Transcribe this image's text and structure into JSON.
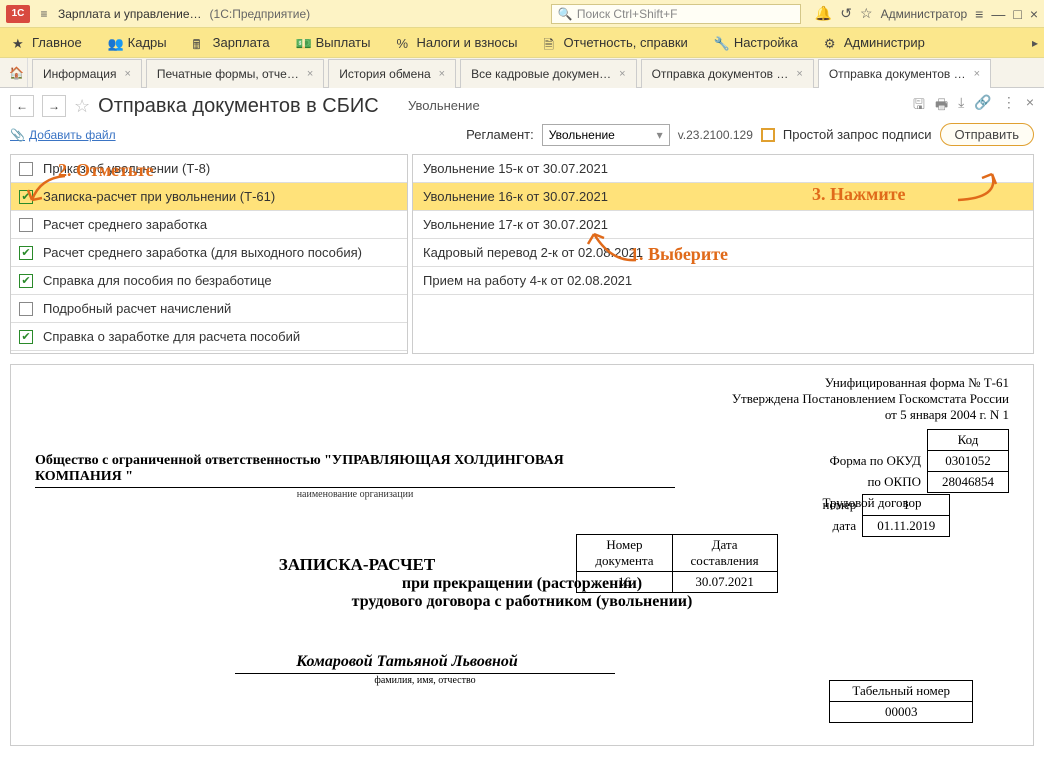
{
  "titlebar": {
    "app": "Зарплата и управление…",
    "subtitle": "(1С:Предприятие)",
    "search_placeholder": "Поиск Ctrl+Shift+F",
    "user": "Администратор"
  },
  "mainmenu": [
    "Главное",
    "Кадры",
    "Зарплата",
    "Выплаты",
    "Налоги и взносы",
    "Отчетность, справки",
    "Настройка",
    "Администрир"
  ],
  "tabs": [
    {
      "label": "Информация"
    },
    {
      "label": "Печатные формы, отче…"
    },
    {
      "label": "История обмена"
    },
    {
      "label": "Все кадровые докумен…"
    },
    {
      "label": "Отправка документов …"
    },
    {
      "label": "Отправка документов …",
      "active": true
    }
  ],
  "form": {
    "title": "Отправка документов в СБИС",
    "subtitle": "Увольнение",
    "attach": "Добавить файл",
    "reg_label": "Регламент:",
    "reg_value": "Увольнение",
    "version": "v.23.2100.129",
    "simple_sign": "Простой запрос подписи",
    "send": "Отправить"
  },
  "left_list": [
    {
      "checked": false,
      "label": "Приказ об увольнении (Т-8)"
    },
    {
      "checked": true,
      "label": "Записка-расчет при увольнении (Т-61)",
      "selected": true
    },
    {
      "checked": false,
      "label": "Расчет среднего заработка"
    },
    {
      "checked": true,
      "label": "Расчет среднего заработка (для выходного пособия)"
    },
    {
      "checked": true,
      "label": "Справка для пособия по безработице"
    },
    {
      "checked": false,
      "label": "Подробный расчет начислений"
    },
    {
      "checked": true,
      "label": "Справка о заработке для расчета пособий"
    }
  ],
  "right_list": [
    {
      "label": "Увольнение 15-к от 30.07.2021"
    },
    {
      "label": "Увольнение 16-к от 30.07.2021",
      "selected": true
    },
    {
      "label": "Увольнение 17-к от 30.07.2021"
    },
    {
      "label": "Кадровый перевод 2-к от 02.08.2021"
    },
    {
      "label": "Прием на работу 4-к от 02.08.2021"
    }
  ],
  "preview": {
    "form_no": "Унифицированная форма № Т-61",
    "approval": "Утверждена Постановлением Госкомстата России",
    "approval_date": "от 5 января 2004 г. N 1",
    "org": "Общество с ограниченной ответственностью \"УПРАВЛЯЮЩАЯ ХОЛДИНГОВАЯ КОМПАНИЯ \"",
    "org_sub": "наименование организации",
    "code_hdr": "Код",
    "okud_lbl": "Форма по ОКУД",
    "okud": "0301052",
    "okpo_lbl": "по ОКПО",
    "okpo": "28046854",
    "td_lbl": "Трудовой договор",
    "num_lbl": "номер",
    "num": "1",
    "date_lbl": "дата",
    "date": "01.11.2019",
    "doc_num_hdr": "Номер\nдокумента",
    "doc_date_hdr": "Дата\nсоставления",
    "doc_num": "16",
    "doc_date": "30.07.2021",
    "title": "ЗАПИСКА-РАСЧЕТ",
    "sub1": "при прекращении (расторжении)",
    "sub2": "трудового договора с работником (увольнении)",
    "tabel_hdr": "Табельный номер",
    "tabel": "00003",
    "emp": "Комаровой Татьяной Львовной",
    "emp_sub": "фамилия, имя, отчество"
  },
  "annotations": {
    "a1": "1. Выберите",
    "a2": "2. Отметьте",
    "a3": "3. Нажмите"
  }
}
